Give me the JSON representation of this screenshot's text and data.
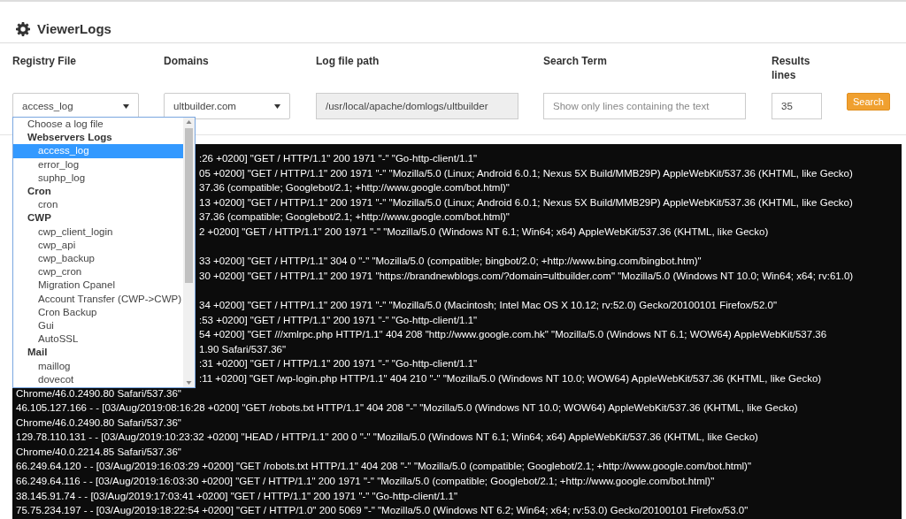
{
  "title": "ViewerLogs",
  "filters": {
    "labels": [
      "Registry File",
      "Domains",
      "Log file path",
      "Search Term",
      "Results lines"
    ],
    "registry_file": {
      "value": "access_log"
    },
    "domain": {
      "value": "ultbuilder.com"
    },
    "log_file_path": {
      "value": "/usr/local/apache/domlogs/ultbuilder",
      "disabled": true
    },
    "search_term": {
      "placeholder": "Show only lines containing the text"
    },
    "results_lines": {
      "value": "35"
    },
    "search_button": "Search"
  },
  "log_menu": {
    "expanded": true,
    "items": [
      {
        "kind": "option",
        "label": "Choose a log file",
        "selected": false
      },
      {
        "kind": "group",
        "label": "Webservers Logs",
        "children": [
          {
            "label": "access_log",
            "selected": true
          },
          {
            "label": "error_log",
            "selected": false
          },
          {
            "label": "suphp_log",
            "selected": false
          }
        ]
      },
      {
        "kind": "group",
        "label": "Cron",
        "children": [
          {
            "label": "cron",
            "selected": false
          }
        ]
      },
      {
        "kind": "group",
        "label": "CWP",
        "children": [
          {
            "label": "cwp_client_login",
            "selected": false
          },
          {
            "label": "cwp_api",
            "selected": false
          },
          {
            "label": "cwp_backup",
            "selected": false
          },
          {
            "label": "cwp_cron",
            "selected": false
          },
          {
            "label": "Migration Cpanel",
            "selected": false
          },
          {
            "label": "Account Transfer (CWP->CWP)",
            "selected": false
          },
          {
            "label": "Cron Backup",
            "selected": false
          },
          {
            "label": "Gui",
            "selected": false
          },
          {
            "label": "AutoSSL",
            "selected": false
          }
        ]
      },
      {
        "kind": "group",
        "label": "Mail",
        "children": [
          {
            "label": "maillog",
            "selected": false
          },
          {
            "label": "dovecot",
            "selected": false
          }
        ]
      }
    ]
  },
  "log": {
    "partial_lines": [
      {
        "text": ":26 +0200] \"GET / HTTP/1.1\" 200 1971 \"-\" \"Go-http-client/1.1\""
      },
      {
        "text": "05 +0200] \"GET / HTTP/1.1\" 200 1971 \"-\" \"Mozilla/5.0 (Linux; Android 6.0.1; Nexus 5X Build/MMB29P) AppleWebKit/537.36 (KHTML, like Gecko)"
      },
      {
        "text": "37.36 (compatible; Googlebot/2.1; +http://www.google.com/bot.html)\""
      },
      {
        "text": "13 +0200] \"GET / HTTP/1.1\" 200 1971 \"-\" \"Mozilla/5.0 (Linux; Android 6.0.1; Nexus 5X Build/MMB29P) AppleWebKit/537.36 (KHTML, like Gecko)"
      },
      {
        "text": "37.36 (compatible; Googlebot/2.1; +http://www.google.com/bot.html)\""
      },
      {
        "text": "2 +0200] \"GET / HTTP/1.1\" 200 1971 \"-\" \"Mozilla/5.0 (Windows NT 6.1; Win64; x64) AppleWebKit/537.36 (KHTML, like Gecko)",
        "hidden_line_after": true
      },
      {
        "text": "33 +0200] \"GET / HTTP/1.1\" 304 0 \"-\" \"Mozilla/5.0 (compatible; bingbot/2.0; +http://www.bing.com/bingbot.htm)\""
      },
      {
        "text": "30 +0200] \"GET / HTTP/1.1\" 200 1971 \"https://brandnewblogs.com/?domain=ultbuilder.com\" \"Mozilla/5.0 (Windows NT 10.0; Win64; x64; rv:61.0)",
        "hidden_line_after": true
      },
      {
        "text": "34 +0200] \"GET / HTTP/1.1\" 200 1971 \"-\" \"Mozilla/5.0 (Macintosh; Intel Mac OS X 10.12; rv:52.0) Gecko/20100101 Firefox/52.0\""
      },
      {
        "text": ":53 +0200] \"GET / HTTP/1.1\" 200 1971 \"-\" \"Go-http-client/1.1\""
      },
      {
        "text": "54 +0200] \"GET ///xmlrpc.php HTTP/1.1\" 404 208 \"http://www.google.com.hk\" \"Mozilla/5.0 (Windows NT 6.1; WOW64) AppleWebKit/537.36"
      },
      {
        "text": "1.90 Safari/537.36\""
      },
      {
        "text": ":31 +0200] \"GET / HTTP/1.1\" 200 1971 \"-\" \"Go-http-client/1.1\""
      },
      {
        "text": ":11 +0200] \"GET /wp-login.php HTTP/1.1\" 404 210 \"-\" \"Mozilla/5.0 (Windows NT 10.0; WOW64) AppleWebKit/537.36 (KHTML, like Gecko)"
      }
    ],
    "lines": [
      "Chrome/46.0.2490.80 Safari/537.36\"",
      "46.105.127.166 - - [03/Aug/2019:08:16:28 +0200] \"GET /robots.txt HTTP/1.1\" 404 208 \"-\" \"Mozilla/5.0 (Windows NT 10.0; WOW64) AppleWebKit/537.36 (KHTML, like Gecko)",
      "Chrome/46.0.2490.80 Safari/537.36\"",
      "129.78.110.131 - - [03/Aug/2019:10:23:32 +0200] \"HEAD / HTTP/1.1\" 200 0 \"-\" \"Mozilla/5.0 (Windows NT 6.1; Win64; x64) AppleWebKit/537.36 (KHTML, like Gecko)",
      "Chrome/40.0.2214.85 Safari/537.36\"",
      "66.249.64.120 - - [03/Aug/2019:16:03:29 +0200] \"GET /robots.txt HTTP/1.1\" 404 208 \"-\" \"Mozilla/5.0 (compatible; Googlebot/2.1; +http://www.google.com/bot.html)\"",
      "66.249.64.116 - - [03/Aug/2019:16:03:30 +0200] \"GET / HTTP/1.1\" 200 1971 \"-\" \"Mozilla/5.0 (compatible; Googlebot/2.1; +http://www.google.com/bot.html)\"",
      "38.145.91.74 - - [03/Aug/2019:17:03:41 +0200] \"GET / HTTP/1.1\" 200 1971 \"-\" \"Go-http-client/1.1\"",
      "75.75.234.197 - - [03/Aug/2019:18:22:54 +0200] \"GET / HTTP/1.0\" 200 5069 \"-\" \"Mozilla/5.0 (Windows NT 6.2; Win64; x64; rv:53.0) Gecko/20100101 Firefox/53.0\""
    ]
  }
}
